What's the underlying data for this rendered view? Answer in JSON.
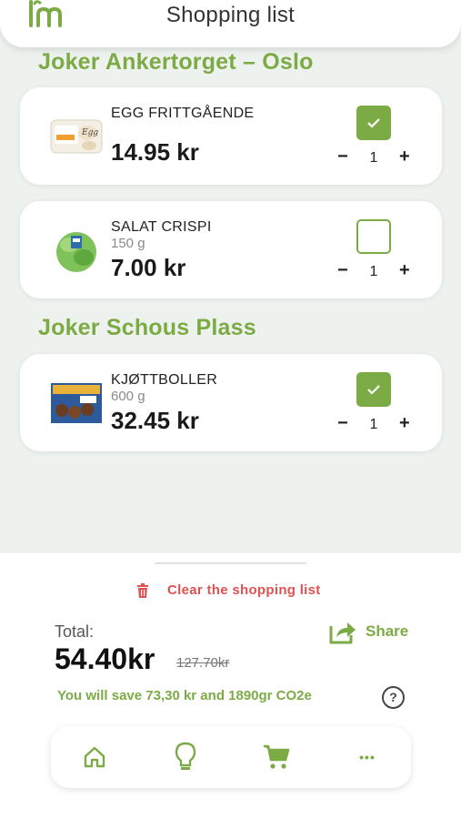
{
  "header": {
    "title": "Shopping list"
  },
  "stores": [
    {
      "name": "Joker Ankertorget – Oslo",
      "items": [
        {
          "name": "EGG FRITTGÅENDE",
          "weight": "",
          "price": "14.95 kr",
          "qty": "1",
          "checked": true
        },
        {
          "name": "SALAT CRISPI",
          "weight": "150 g",
          "price": "7.00 kr",
          "qty": "1",
          "checked": false
        }
      ]
    },
    {
      "name": "Joker Schous Plass",
      "items": [
        {
          "name": "KJØTTBOLLER",
          "weight": "600 g",
          "price": "32.45 kr",
          "qty": "1",
          "checked": true
        }
      ]
    }
  ],
  "controls": {
    "minus": "−",
    "plus": "+"
  },
  "footer": {
    "clear_label": "Clear the shopping list",
    "total_label": "Total:",
    "total_amount": "54.40kr",
    "total_old": "127.70kr",
    "share_label": "Share",
    "savings": "You will save 73,30 kr and 1890gr CO2e",
    "help": "?"
  },
  "nav": {
    "icons": [
      "home-icon",
      "lightbulb-icon",
      "cart-icon",
      "more-icon"
    ],
    "more_glyph": "•••"
  },
  "colors": {
    "accent": "#7cab45",
    "danger": "#e05252",
    "background": "#eef2ee"
  }
}
